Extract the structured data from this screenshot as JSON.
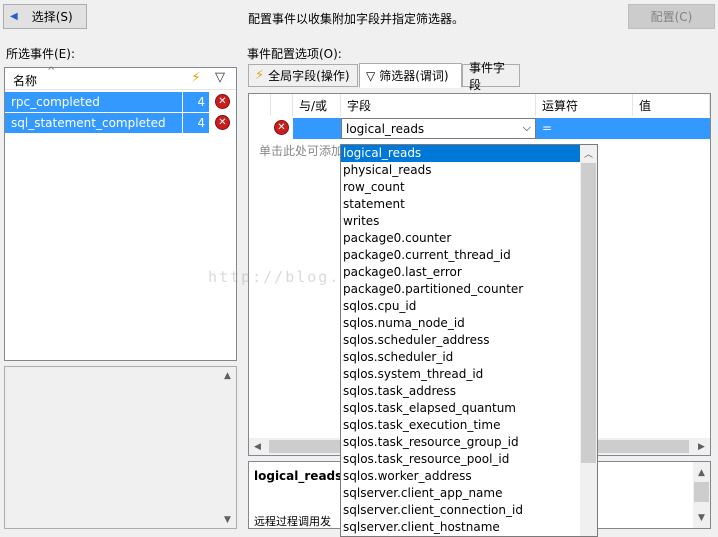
{
  "toolbar": {
    "select_label": "选择(S)",
    "description": "配置事件以收集附加字段并指定筛选器。",
    "configure_label": "配置(C)"
  },
  "selected_events": {
    "label": "所选事件(E):",
    "col_name": "名称",
    "events": [
      {
        "name": "rpc_completed",
        "count": "4"
      },
      {
        "name": "sql_statement_completed",
        "count": "4"
      }
    ]
  },
  "config": {
    "label": "事件配置选项(O):",
    "tabs": [
      "全局字段(操作)",
      "筛选器(谓词)",
      "事件字段"
    ],
    "grid_headers": {
      "andor": "与/或",
      "field": "字段",
      "operator": "运算符",
      "value": "值"
    },
    "row": {
      "field": "logical_reads",
      "operator": "="
    },
    "add_hint": "单击此处可添加",
    "desc_title": "logical_reads (",
    "desc_text": "远程过程调用发"
  },
  "dropdown_items": [
    "logical_reads",
    "physical_reads",
    "row_count",
    "statement",
    "writes",
    "package0.counter",
    "package0.current_thread_id",
    "package0.last_error",
    "package0.partitioned_counter",
    "sqlos.cpu_id",
    "sqlos.numa_node_id",
    "sqlos.scheduler_address",
    "sqlos.scheduler_id",
    "sqlos.system_thread_id",
    "sqlos.task_address",
    "sqlos.task_elapsed_quantum",
    "sqlos.task_execution_time",
    "sqlos.task_resource_group_id",
    "sqlos.task_resource_pool_id",
    "sqlos.worker_address",
    "sqlserver.client_app_name",
    "sqlserver.client_connection_id",
    "sqlserver.client_hostname"
  ],
  "watermark": "http://blog.c                duangzj",
  "colors": {
    "selection": "#3399ff",
    "dropdown_selection": "#0078d7",
    "delete_icon": "#c81e1e"
  }
}
